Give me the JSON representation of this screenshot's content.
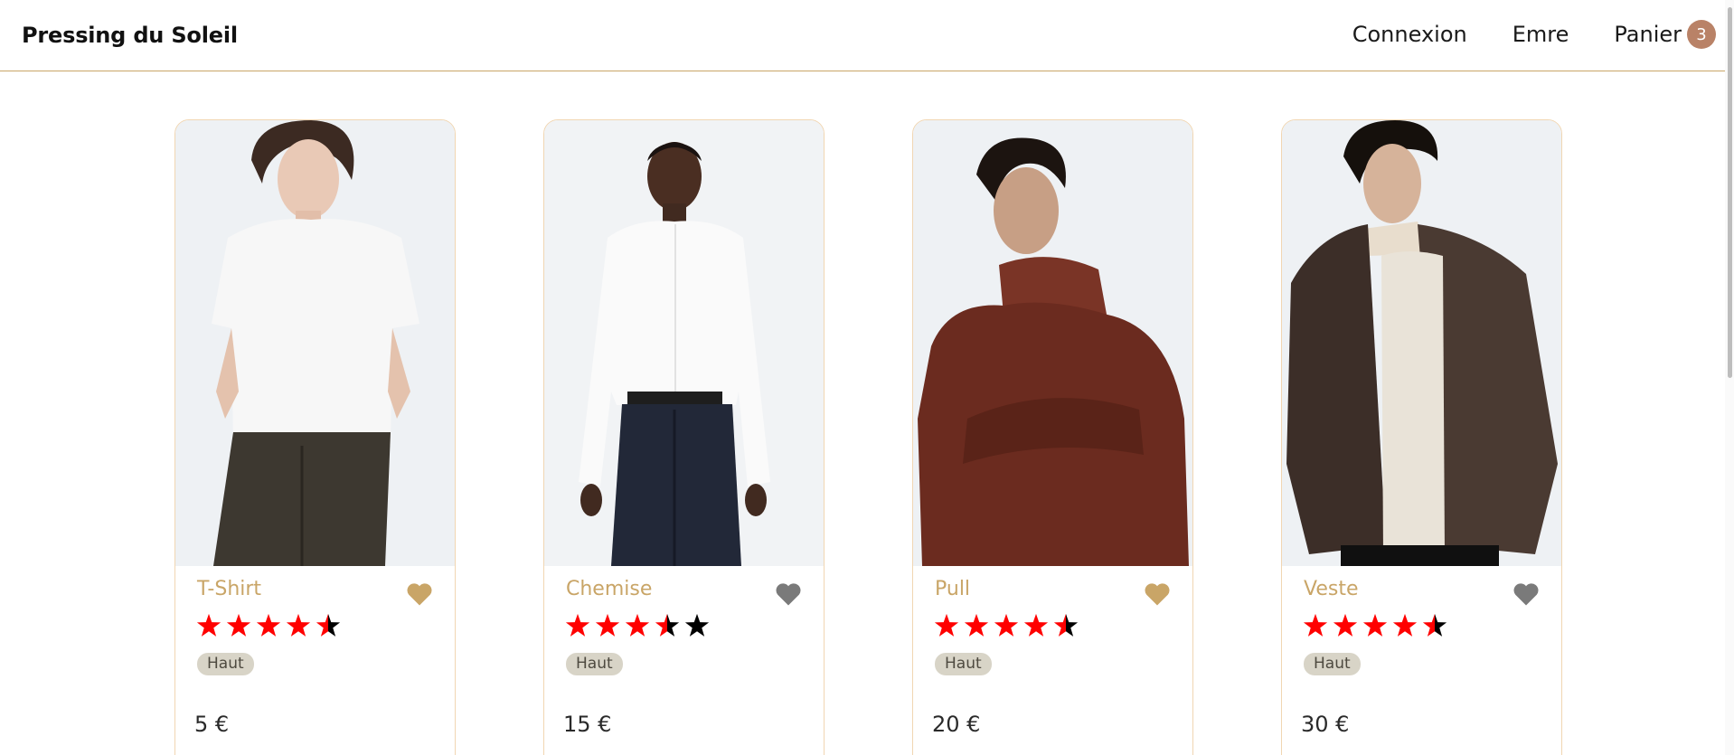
{
  "header": {
    "brand": "Pressing du Soleil",
    "nav": {
      "login": "Connexion",
      "user": "Emre",
      "cart": "Panier",
      "cart_count": "3"
    }
  },
  "colors": {
    "accent": "#c9a567",
    "badge": "#b98267",
    "star": "#ff0000",
    "heart_active": "#c9a567",
    "heart_inactive": "#7a7a7a"
  },
  "products": [
    {
      "name": "T-Shirt",
      "rating": 4.5,
      "category": "Haut",
      "price": "5 €",
      "favorite": true,
      "icon": "heart-icon"
    },
    {
      "name": "Chemise",
      "rating": 3.5,
      "category": "Haut",
      "price": "15 €",
      "favorite": false,
      "icon": "heart-icon"
    },
    {
      "name": "Pull",
      "rating": 4.5,
      "category": "Haut",
      "price": "20 €",
      "favorite": true,
      "icon": "heart-icon"
    },
    {
      "name": "Veste",
      "rating": 4.5,
      "category": "Haut",
      "price": "30 €",
      "favorite": false,
      "icon": "heart-icon"
    }
  ]
}
